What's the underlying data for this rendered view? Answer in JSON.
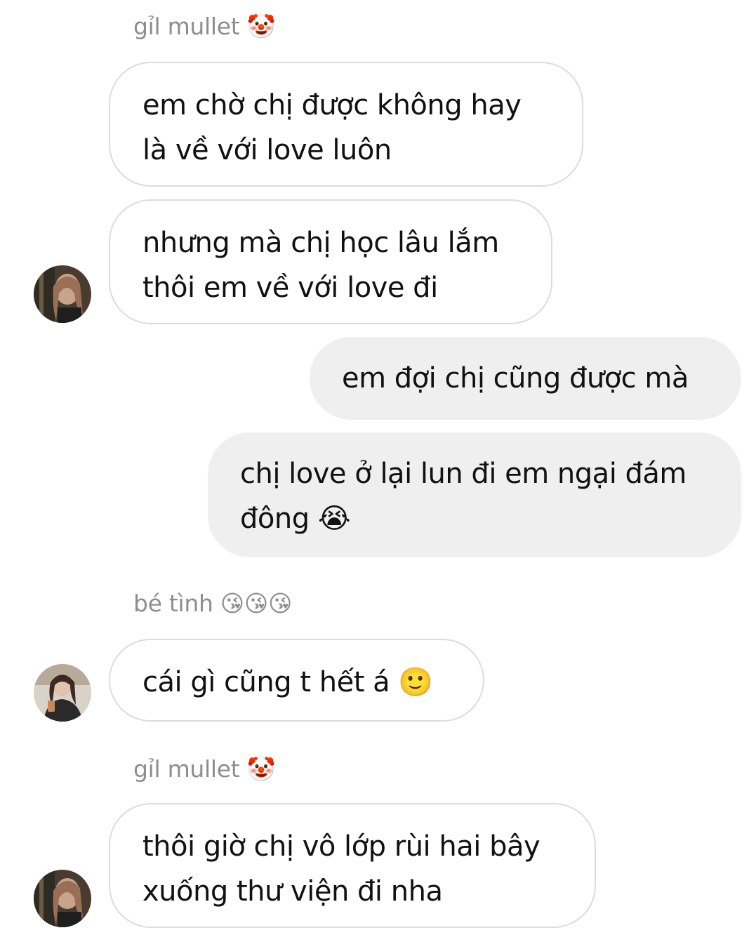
{
  "conversation": {
    "messages": [
      {
        "sender": "gỉl mullet 🤡",
        "text": "em chờ chị được không hay\nlà về với love luôn"
      },
      {
        "text": "nhưng mà chị học lâu lắm\nthôi em về với love đi"
      },
      {
        "text": "em đợi chị cũng được mà"
      },
      {
        "text": "chị love ở lại lun đi em ngại đám\nđông 😭"
      },
      {
        "sender": "bé tình 😘😘😘",
        "text": "cái gì cũng t hết á 🙂"
      },
      {
        "sender": "gỉl mullet 🤡",
        "text": "thôi giờ chị vô lớp rùi hai bây\nxuống thư viện đi nha"
      }
    ]
  },
  "colors": {
    "sender_name": "#8e8e8e",
    "incoming_border": "#dcdcdc",
    "outgoing_bg": "#efefef"
  },
  "icons": [
    "avatar-gil-mullet",
    "avatar-be-tinh"
  ]
}
